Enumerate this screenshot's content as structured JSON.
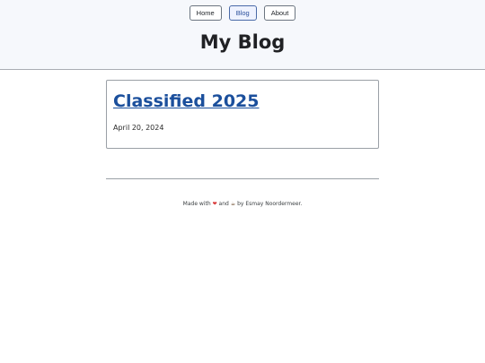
{
  "nav": {
    "items": [
      {
        "label": "Home"
      },
      {
        "label": "Blog"
      },
      {
        "label": "About"
      }
    ]
  },
  "header": {
    "title": "My Blog"
  },
  "posts": [
    {
      "title": "Classified 2025",
      "date": "April 20, 2024"
    }
  ],
  "footer": {
    "made_with": "Made with",
    "and": "and",
    "by": "by Esmay Noordermeer.",
    "heart_icon": "heart-icon",
    "coffee_icon": "coffee-icon",
    "heart_color": "#d93a3a"
  }
}
